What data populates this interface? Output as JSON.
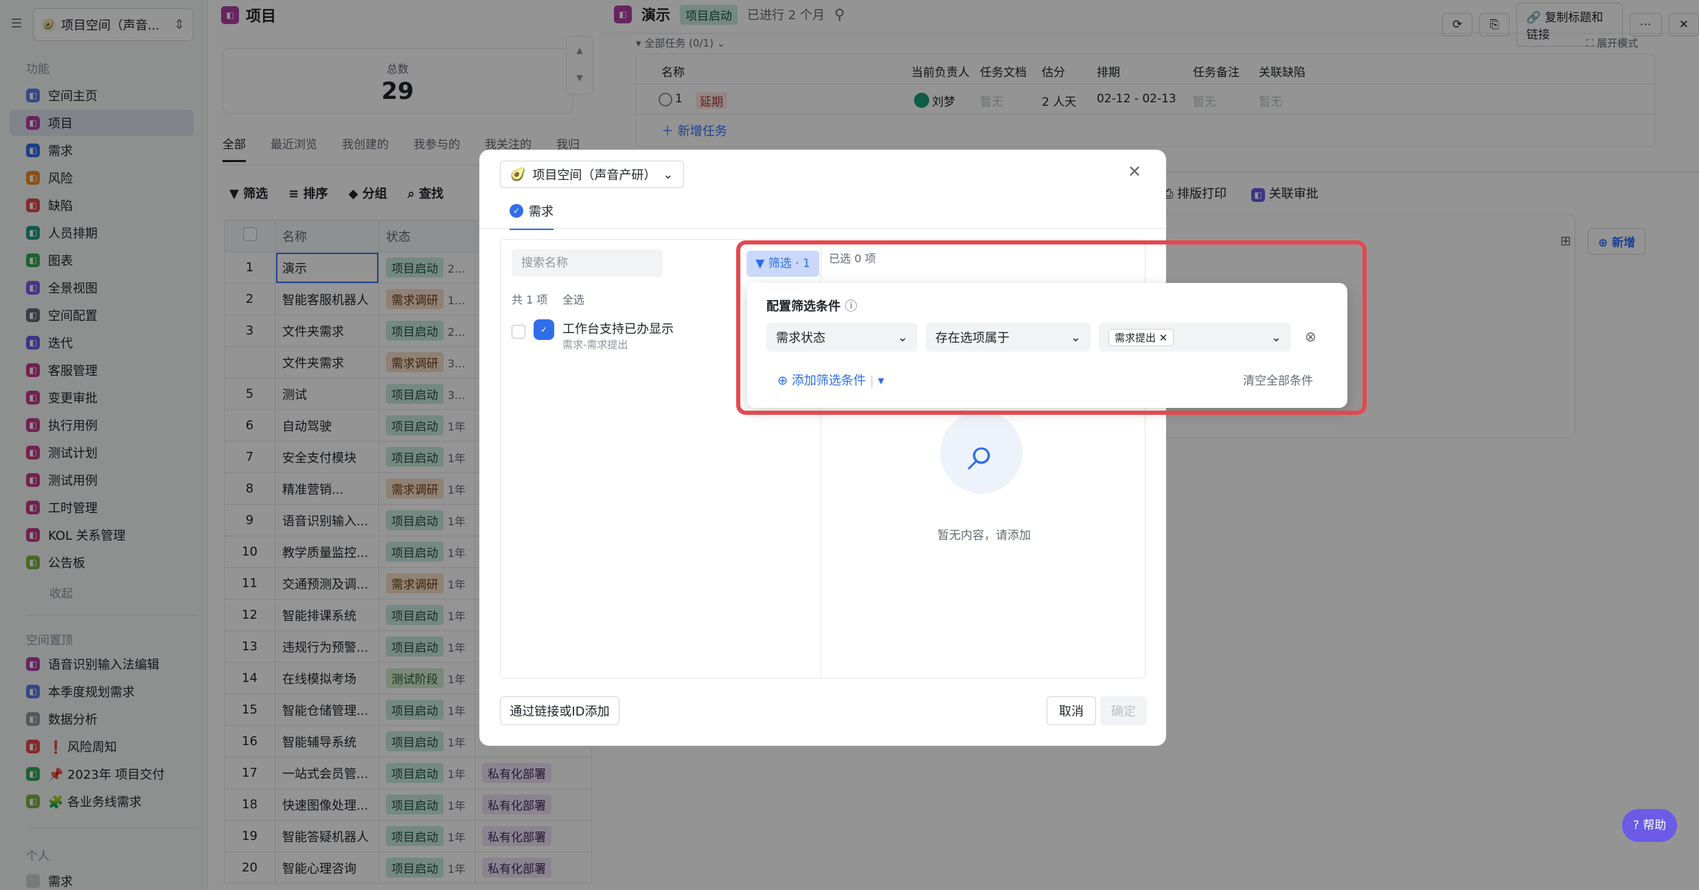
{
  "sidebar": {
    "space_name": "项目空间（声音...",
    "section_features": "功能",
    "items": [
      {
        "label": "空间主页",
        "color": "#5b7ce6"
      },
      {
        "label": "项目",
        "color": "#b23ea8"
      },
      {
        "label": "需求",
        "color": "#2f6ee8"
      },
      {
        "label": "风险",
        "color": "#f08a24"
      },
      {
        "label": "缺陷",
        "color": "#e5484d"
      },
      {
        "label": "人员排期",
        "color": "#1a9f7a"
      },
      {
        "label": "图表",
        "color": "#34a853"
      },
      {
        "label": "全景视图",
        "color": "#7a5be6"
      },
      {
        "label": "空间配置",
        "color": "#646a73"
      },
      {
        "label": "迭代",
        "color": "#6b5be6"
      },
      {
        "label": "客服管理",
        "color": "#c43a8a"
      },
      {
        "label": "变更审批",
        "color": "#c43a8a"
      },
      {
        "label": "执行用例",
        "color": "#c43a8a"
      },
      {
        "label": "测试计划",
        "color": "#c43a8a"
      },
      {
        "label": "测试用例",
        "color": "#c43a8a"
      },
      {
        "label": "工时管理",
        "color": "#c43a8a"
      },
      {
        "label": "KOL 关系管理",
        "color": "#c43a8a"
      },
      {
        "label": "公告板",
        "color": "#7cb342"
      }
    ],
    "collapse": "收起",
    "section_pinned": "空间置顶",
    "pinned": [
      {
        "label": "语音识别输入法编辑",
        "color": "#b23ea8"
      },
      {
        "label": "本季度规划需求",
        "color": "#5b7ce6"
      },
      {
        "label": "数据分析",
        "color": "#8f959e"
      },
      {
        "label": "❗ 风险周知",
        "color": "#e5484d"
      },
      {
        "label": "📌 2023年 项目交付",
        "color": "#34a853"
      },
      {
        "label": "🧩 各业务线需求",
        "color": "#7cb342"
      }
    ],
    "section_personal": "个人",
    "personal": [
      {
        "label": "需求"
      }
    ]
  },
  "list": {
    "title": "项目",
    "total_label": "总数",
    "total_value": "29",
    "tabs": [
      "全部",
      "最近浏览",
      "我创建的",
      "我参与的",
      "我关注的",
      "我归"
    ],
    "toolbar": [
      "筛选",
      "排序",
      "分组",
      "查找"
    ],
    "columns": [
      "名称",
      "状态"
    ],
    "rows": [
      {
        "no": "1",
        "name": "演示",
        "status": "项目启动",
        "tail": "2...",
        "tone": "g"
      },
      {
        "no": "2",
        "name": "智能客服机器人",
        "status": "需求调研",
        "tail": "1...",
        "tone": "o"
      },
      {
        "no": "3",
        "name": "文件夹需求",
        "status": "项目启动",
        "tail": "2...",
        "tone": "g"
      },
      {
        "no": "",
        "name": "文件夹需求",
        "status": "需求调研",
        "tail": "3...",
        "tone": "o"
      },
      {
        "no": "5",
        "name": "测试",
        "status": "项目启动",
        "tail": "3...",
        "tone": "g"
      },
      {
        "no": "6",
        "name": "自动驾驶",
        "status": "项目启动",
        "tail": "1年",
        "tone": "g"
      },
      {
        "no": "7",
        "name": "安全支付模块",
        "status": "项目启动",
        "tail": "1年",
        "tone": "g"
      },
      {
        "no": "8",
        "name": "精准营销...",
        "status": "需求调研",
        "tail": "1年",
        "tone": "o"
      },
      {
        "no": "9",
        "name": "语音识别输入...",
        "status": "项目启动",
        "tail": "1年",
        "tone": "g"
      },
      {
        "no": "10",
        "name": "教学质量监控...",
        "status": "项目启动",
        "tail": "1年",
        "tone": "g"
      },
      {
        "no": "11",
        "name": "交通预测及调...",
        "status": "需求调研",
        "tail": "1年",
        "tone": "o"
      },
      {
        "no": "12",
        "name": "智能排课系统",
        "status": "项目启动",
        "tail": "1年",
        "tone": "g"
      },
      {
        "no": "13",
        "name": "违规行为预警...",
        "status": "项目启动",
        "tail": "1年",
        "tone": "g"
      },
      {
        "no": "14",
        "name": "在线模拟考场",
        "status": "测试阶段",
        "tail": "1年",
        "tone": "t"
      },
      {
        "no": "15",
        "name": "智能仓储管理...",
        "status": "项目启动",
        "tail": "1年",
        "tone": "g"
      },
      {
        "no": "16",
        "name": "智能辅导系统",
        "status": "项目启动",
        "tail": "1年",
        "tone": "g"
      },
      {
        "no": "17",
        "name": "一站式会员管...",
        "status": "项目启动",
        "tail": "1年",
        "tone": "g",
        "extra": "私有化部署"
      },
      {
        "no": "18",
        "name": "快速图像处理...",
        "status": "项目启动",
        "tail": "1年",
        "tone": "g",
        "extra": "私有化部署"
      },
      {
        "no": "19",
        "name": "智能答疑机器人",
        "status": "项目启动",
        "tail": "1年",
        "tone": "g",
        "extra": "私有化部署"
      },
      {
        "no": "20",
        "name": "智能心理咨询",
        "status": "项目启动",
        "tail": "1年",
        "tone": "g",
        "extra": "私有化部署"
      }
    ]
  },
  "detail": {
    "title": "演示",
    "status": "项目启动",
    "duration": "已进行 2 个月",
    "copy_btn": "复制标题和链接",
    "section": "全部任务 (0/1)",
    "expand": "展开模式",
    "columns": [
      "名称",
      "当前负责人",
      "任务文档",
      "估分",
      "排期",
      "任务备注",
      "关联缺陷"
    ],
    "task": {
      "no": "1",
      "tag": "延期",
      "owner": "刘梦",
      "doc": "暂无",
      "estimate": "2 人天",
      "schedule": "02-12 - 02-13",
      "note": "暂无",
      "defect": "暂无"
    },
    "add_task": "新增任务",
    "print": "排版打印",
    "approval": "关联审批",
    "new_btn": "新增",
    "help": "帮助"
  },
  "modal": {
    "space": "项目空间（声音产研）",
    "tab": "需求",
    "search_placeholder": "搜索名称",
    "filter_btn": "筛选 · 1",
    "selected": "已选 0 项",
    "count": "共 1 项",
    "select_all": "全选",
    "item_title": "工作台支持已办显示",
    "item_sub": "需求-需求提出",
    "empty": "暂无内容，请添加",
    "add_by_link": "通过链接或ID添加",
    "cancel": "取消",
    "confirm": "确定"
  },
  "filter": {
    "title": "配置筛选条件",
    "field": "需求状态",
    "operator": "存在选项属于",
    "value_chip": "需求提出",
    "add": "添加筛选条件",
    "clear": "清空全部条件"
  }
}
